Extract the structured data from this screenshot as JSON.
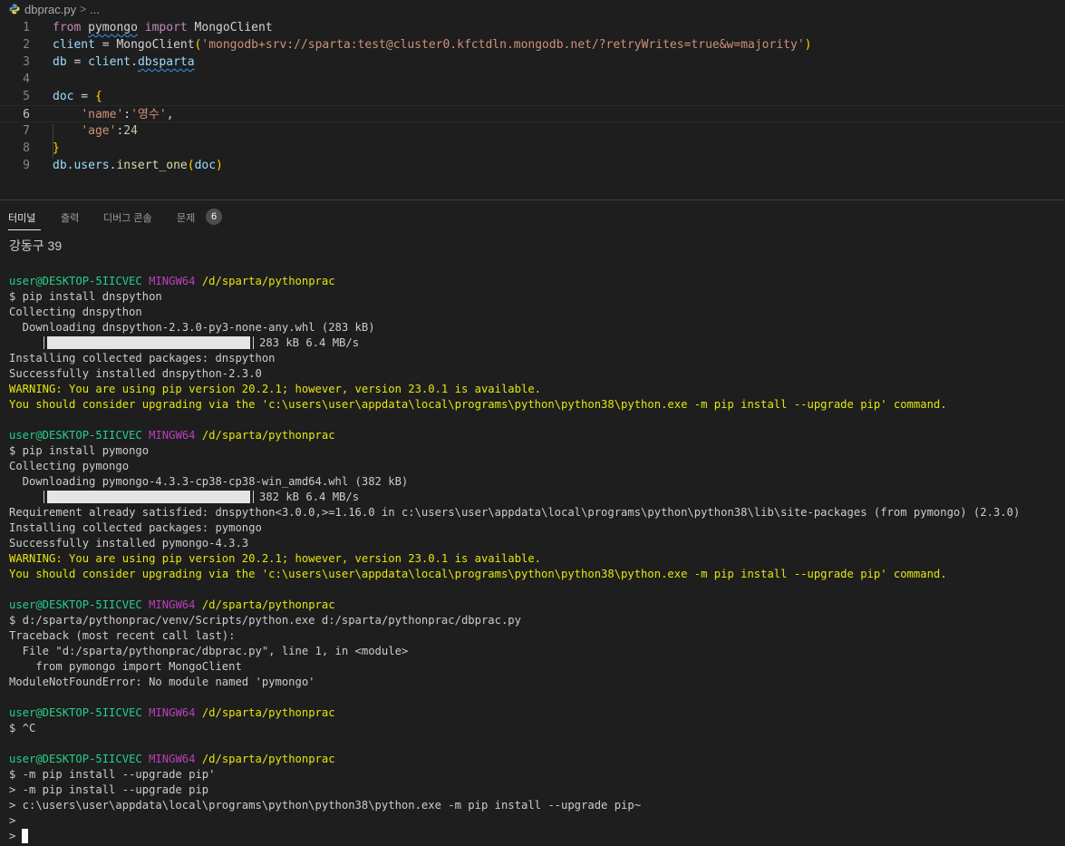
{
  "breadcrumb": {
    "file": "dbprac.py",
    "sep": ">",
    "more": "..."
  },
  "editor": {
    "lines": [
      {
        "num": "1",
        "tokens": [
          {
            "t": "from",
            "c": "kw"
          },
          {
            "t": " ",
            "c": "pl"
          },
          {
            "t": "pymongo",
            "c": "pl",
            "squig": true
          },
          {
            "t": " ",
            "c": "pl"
          },
          {
            "t": "import",
            "c": "kw"
          },
          {
            "t": " MongoClient",
            "c": "pl"
          }
        ]
      },
      {
        "num": "2",
        "tokens": [
          {
            "t": "client",
            "c": "var"
          },
          {
            "t": " = ",
            "c": "pl"
          },
          {
            "t": "MongoClient",
            "c": "pl"
          },
          {
            "t": "(",
            "c": "br1"
          },
          {
            "t": "'mongodb+srv://sparta:test@cluster0.kfctdln.mongodb.net/?retryWrites=true&w=majority'",
            "c": "str"
          },
          {
            "t": ")",
            "c": "br1"
          }
        ]
      },
      {
        "num": "3",
        "tokens": [
          {
            "t": "db",
            "c": "var"
          },
          {
            "t": " = ",
            "c": "pl"
          },
          {
            "t": "client",
            "c": "var"
          },
          {
            "t": ".",
            "c": "pl"
          },
          {
            "t": "dbsparta",
            "c": "var",
            "squig": true
          }
        ]
      },
      {
        "num": "4",
        "tokens": []
      },
      {
        "num": "5",
        "tokens": [
          {
            "t": "doc",
            "c": "var"
          },
          {
            "t": " = ",
            "c": "pl"
          },
          {
            "t": "{",
            "c": "br1"
          }
        ]
      },
      {
        "num": "6",
        "tokens": [
          {
            "t": "    ",
            "c": "pl"
          },
          {
            "t": "'name'",
            "c": "str"
          },
          {
            "t": ":",
            "c": "pl"
          },
          {
            "t": "'영수'",
            "c": "str"
          },
          {
            "t": ",",
            "c": "pl"
          }
        ],
        "current": true
      },
      {
        "num": "7",
        "tokens": [
          {
            "t": "    ",
            "c": "pl"
          },
          {
            "t": "'age'",
            "c": "str"
          },
          {
            "t": ":",
            "c": "pl"
          },
          {
            "t": "24",
            "c": "num"
          }
        ]
      },
      {
        "num": "8",
        "tokens": [
          {
            "t": "}",
            "c": "br1"
          }
        ]
      },
      {
        "num": "9",
        "tokens": [
          {
            "t": "db",
            "c": "var"
          },
          {
            "t": ".",
            "c": "pl"
          },
          {
            "t": "users",
            "c": "var"
          },
          {
            "t": ".",
            "c": "pl"
          },
          {
            "t": "insert_one",
            "c": "fn"
          },
          {
            "t": "(",
            "c": "br1"
          },
          {
            "t": "doc",
            "c": "var"
          },
          {
            "t": ")",
            "c": "br1"
          }
        ]
      }
    ]
  },
  "panel": {
    "tabs": [
      {
        "label": "터미널",
        "active": true,
        "key": "terminal"
      },
      {
        "label": "출력",
        "active": false,
        "key": "output"
      },
      {
        "label": "디버그 콘솔",
        "active": false,
        "key": "debug-console"
      },
      {
        "label": "문제",
        "active": false,
        "key": "problems"
      }
    ],
    "problems_count": "6"
  },
  "prompt": {
    "user": "user@DESKTOP-5IICVEC",
    "shell": "MINGW64",
    "path": "/d/sparta/pythonprac"
  },
  "terminal": {
    "lines": [
      {
        "type": "big",
        "text": "강동구 39"
      },
      {
        "type": "blank"
      },
      {
        "type": "prompt"
      },
      {
        "type": "plain",
        "text": "$ pip install dnspython"
      },
      {
        "type": "plain",
        "text": "Collecting dnspython"
      },
      {
        "type": "plain",
        "text": "  Downloading dnspython-2.3.0-py3-none-any.whl (283 kB)"
      },
      {
        "type": "progress",
        "text": "283 kB 6.4 MB/s",
        "progress": 1.0
      },
      {
        "type": "plain",
        "text": "Installing collected packages: dnspython"
      },
      {
        "type": "plain",
        "text": "Successfully installed dnspython-2.3.0"
      },
      {
        "type": "warn",
        "text": "WARNING: You are using pip version 20.2.1; however, version 23.0.1 is available."
      },
      {
        "type": "warn",
        "text": "You should consider upgrading via the 'c:\\users\\user\\appdata\\local\\programs\\python\\python38\\python.exe -m pip install --upgrade pip' command."
      },
      {
        "type": "blank"
      },
      {
        "type": "prompt"
      },
      {
        "type": "plain",
        "text": "$ pip install pymongo"
      },
      {
        "type": "plain",
        "text": "Collecting pymongo"
      },
      {
        "type": "plain",
        "text": "  Downloading pymongo-4.3.3-cp38-cp38-win_amd64.whl (382 kB)"
      },
      {
        "type": "progress",
        "text": "382 kB 6.4 MB/s",
        "progress": 1.0
      },
      {
        "type": "plain",
        "text": "Requirement already satisfied: dnspython<3.0.0,>=1.16.0 in c:\\users\\user\\appdata\\local\\programs\\python\\python38\\lib\\site-packages (from pymongo) (2.3.0)"
      },
      {
        "type": "plain",
        "text": "Installing collected packages: pymongo"
      },
      {
        "type": "plain",
        "text": "Successfully installed pymongo-4.3.3"
      },
      {
        "type": "warn",
        "text": "WARNING: You are using pip version 20.2.1; however, version 23.0.1 is available."
      },
      {
        "type": "warn",
        "text": "You should consider upgrading via the 'c:\\users\\user\\appdata\\local\\programs\\python\\python38\\python.exe -m pip install --upgrade pip' command."
      },
      {
        "type": "blank"
      },
      {
        "type": "prompt"
      },
      {
        "type": "plain",
        "text": "$ d:/sparta/pythonprac/venv/Scripts/python.exe d:/sparta/pythonprac/dbprac.py"
      },
      {
        "type": "plain",
        "text": "Traceback (most recent call last):"
      },
      {
        "type": "plain",
        "text": "  File \"d:/sparta/pythonprac/dbprac.py\", line 1, in <module>"
      },
      {
        "type": "plain",
        "text": "    from pymongo import MongoClient"
      },
      {
        "type": "plain",
        "text": "ModuleNotFoundError: No module named 'pymongo'"
      },
      {
        "type": "blank"
      },
      {
        "type": "prompt"
      },
      {
        "type": "plain",
        "text": "$ ^C"
      },
      {
        "type": "blank"
      },
      {
        "type": "prompt"
      },
      {
        "type": "plain",
        "text": "$ -m pip install --upgrade pip'"
      },
      {
        "type": "plain",
        "text": "> -m pip install --upgrade pip"
      },
      {
        "type": "plain",
        "text": "> c:\\users\\user\\appdata\\local\\programs\\python\\python38\\python.exe -m pip install --upgrade pip~"
      },
      {
        "type": "plain",
        "text": ">"
      },
      {
        "type": "cursor",
        "text": ">"
      }
    ]
  }
}
